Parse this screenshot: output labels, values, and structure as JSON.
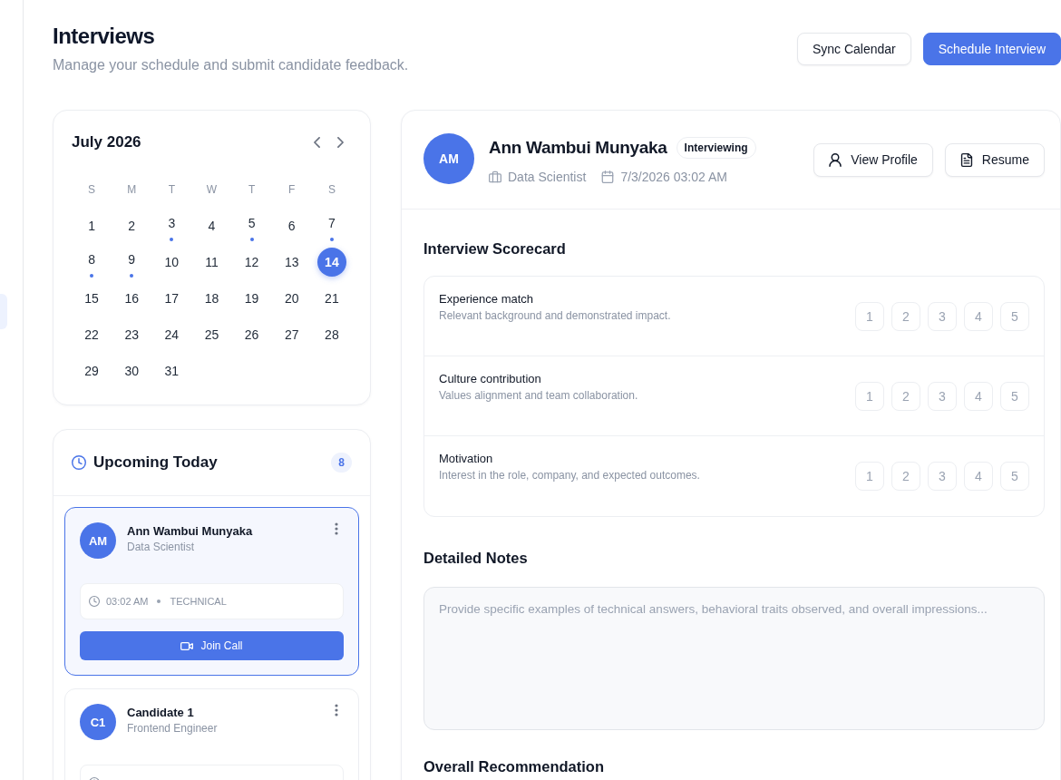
{
  "page": {
    "title": "Interviews",
    "subtitle": "Manage your schedule and submit candidate feedback.",
    "actions": [
      {
        "label": "Sync Calendar",
        "kind": "secondary"
      },
      {
        "label": "Schedule Interview",
        "kind": "primary"
      }
    ]
  },
  "calendar": {
    "month": "July 2026",
    "weekdays": [
      "S",
      "M",
      "T",
      "W",
      "T",
      "F",
      "S"
    ],
    "days": [
      {
        "label": "1",
        "has_interview": false,
        "selected": false
      },
      {
        "label": "2",
        "has_interview": false,
        "selected": false
      },
      {
        "label": "3",
        "has_interview": true,
        "selected": false
      },
      {
        "label": "4",
        "has_interview": false,
        "selected": false
      },
      {
        "label": "5",
        "has_interview": true,
        "selected": false
      },
      {
        "label": "6",
        "has_interview": false,
        "selected": false
      },
      {
        "label": "7",
        "has_interview": true,
        "selected": false
      },
      {
        "label": "8",
        "has_interview": true,
        "selected": false
      },
      {
        "label": "9",
        "has_interview": true,
        "selected": false
      },
      {
        "label": "10",
        "has_interview": false,
        "selected": false
      },
      {
        "label": "11",
        "has_interview": false,
        "selected": false
      },
      {
        "label": "12",
        "has_interview": false,
        "selected": false
      },
      {
        "label": "13",
        "has_interview": false,
        "selected": false
      },
      {
        "label": "14",
        "has_interview": false,
        "selected": true
      },
      {
        "label": "15",
        "has_interview": false,
        "selected": false
      },
      {
        "label": "16",
        "has_interview": false,
        "selected": false
      },
      {
        "label": "17",
        "has_interview": false,
        "selected": false
      },
      {
        "label": "18",
        "has_interview": false,
        "selected": false
      },
      {
        "label": "19",
        "has_interview": false,
        "selected": false
      },
      {
        "label": "20",
        "has_interview": false,
        "selected": false
      },
      {
        "label": "21",
        "has_interview": false,
        "selected": false
      },
      {
        "label": "22",
        "has_interview": false,
        "selected": false
      },
      {
        "label": "23",
        "has_interview": false,
        "selected": false
      },
      {
        "label": "24",
        "has_interview": false,
        "selected": false
      },
      {
        "label": "25",
        "has_interview": false,
        "selected": false
      },
      {
        "label": "26",
        "has_interview": false,
        "selected": false
      },
      {
        "label": "27",
        "has_interview": false,
        "selected": false
      },
      {
        "label": "28",
        "has_interview": false,
        "selected": false
      },
      {
        "label": "29",
        "has_interview": false,
        "selected": false
      },
      {
        "label": "30",
        "has_interview": false,
        "selected": false
      },
      {
        "label": "31",
        "has_interview": false,
        "selected": false
      }
    ]
  },
  "upcoming": {
    "title": "Upcoming Today",
    "count": "8",
    "items": [
      {
        "initials": "AM",
        "name": "Ann Wambui Munyaka",
        "role": "Data Scientist",
        "selected": true,
        "time": "03:02 AM",
        "type": "TECHNICAL",
        "action": "Join Call"
      },
      {
        "initials": "C1",
        "name": "Candidate 1",
        "role": "Frontend Engineer",
        "selected": false
      }
    ]
  },
  "candidate": {
    "initials": "AM",
    "name": "Ann Wambui Munyaka",
    "status": "Interviewing",
    "role": "Data Scientist",
    "datetime": "7/3/2026 03:02 AM",
    "actions": [
      {
        "label": "View Profile",
        "kind": "profile"
      },
      {
        "label": "Resume",
        "kind": "resume"
      }
    ]
  },
  "scorecard": {
    "title": "Interview Scorecard",
    "criteria": [
      {
        "name": "Experience match",
        "description": "Relevant background and demonstrated impact.",
        "ratings": [
          {
            "label": "1",
            "selected": false
          },
          {
            "label": "2",
            "selected": false
          },
          {
            "label": "3",
            "selected": false
          },
          {
            "label": "4",
            "selected": false
          },
          {
            "label": "5",
            "selected": false
          }
        ]
      },
      {
        "name": "Culture contribution",
        "description": "Values alignment and team collaboration.",
        "ratings": [
          {
            "label": "1",
            "selected": false
          },
          {
            "label": "2",
            "selected": false
          },
          {
            "label": "3",
            "selected": false
          },
          {
            "label": "4",
            "selected": false
          },
          {
            "label": "5",
            "selected": false
          }
        ]
      },
      {
        "name": "Motivation",
        "description": "Interest in the role, company, and expected outcomes.",
        "ratings": [
          {
            "label": "1",
            "selected": false
          },
          {
            "label": "2",
            "selected": false
          },
          {
            "label": "3",
            "selected": false
          },
          {
            "label": "4",
            "selected": false
          },
          {
            "label": "5",
            "selected": false
          }
        ]
      }
    ]
  },
  "notes": {
    "title": "Detailed Notes",
    "placeholder": "Provide specific examples of technical answers, behavioral traits observed, and overall impressions..."
  },
  "recommendation": {
    "title": "Overall Recommendation"
  }
}
